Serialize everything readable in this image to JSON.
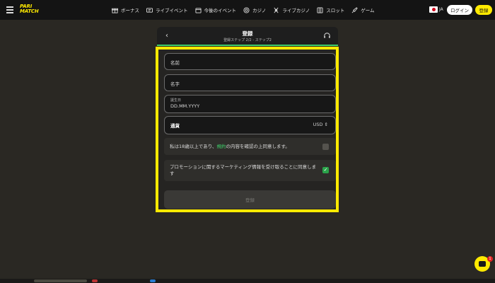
{
  "header": {
    "logo_line1": "PARI",
    "logo_line2": "MATCH",
    "nav": [
      {
        "icon": "gift-icon",
        "label": "ボーナス"
      },
      {
        "icon": "live-events-icon",
        "label": "ライブイベント"
      },
      {
        "icon": "calendar-icon",
        "label": "今後のイベント"
      },
      {
        "icon": "casino-chip-icon",
        "label": "カジノ"
      },
      {
        "icon": "live-casino-icon",
        "label": "ライブカジノ"
      },
      {
        "icon": "slot-icon",
        "label": "スロット"
      },
      {
        "icon": "rocket-icon",
        "label": "ゲーム"
      }
    ],
    "lang": "JA",
    "login_label": "ログイン",
    "register_label": "登録"
  },
  "modal": {
    "title": "登録",
    "subtitle": "登録ステップ 2/2 - ステップ2"
  },
  "form": {
    "first_name_placeholder": "名前",
    "last_name_placeholder": "名字",
    "birthdate_label": "誕生日",
    "birthdate_value": "DD.MM.YYYY",
    "currency_label": "通貨",
    "currency_value": "USD",
    "age_text_before": "私は18歳以上であり、",
    "age_link": "規約",
    "age_text_after": "の内容を確認の上同意します。",
    "age_checked": false,
    "promo_text": "プロモーションに関するマーケティング情報を受け取ることに同意します",
    "promo_checked": true,
    "submit_label": "登録"
  },
  "chat": {
    "badge": "1"
  },
  "colors": {
    "accent": "#ffea00",
    "progress": "#3ed06a",
    "check": "#2aa34a"
  }
}
